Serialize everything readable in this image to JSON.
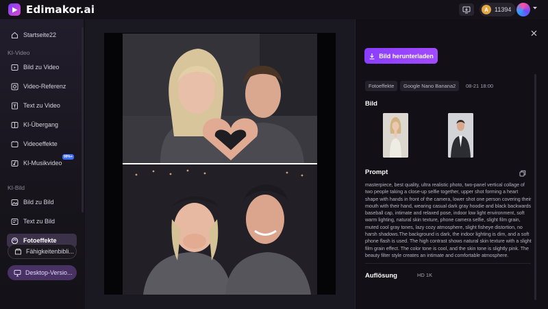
{
  "app": {
    "name": "Edimakor.ai",
    "credits": "11394"
  },
  "sidebar": {
    "home": "Startseite22",
    "video_section": "KI-Video",
    "video_items": [
      {
        "label": "Bild zu Video",
        "icon": "image-to-video-icon"
      },
      {
        "label": "Video-Referenz",
        "icon": "video-reference-icon"
      },
      {
        "label": "Text zu Video",
        "icon": "text-to-video-icon"
      },
      {
        "label": "KI-Übergang",
        "icon": "transition-icon"
      },
      {
        "label": "Videoeffekte",
        "icon": "video-effects-icon"
      },
      {
        "label": "KI-Musikvideo",
        "icon": "music-video-icon",
        "badge": "99%+"
      }
    ],
    "image_section": "KI-Bild",
    "image_items": [
      {
        "label": "Bild zu Bild",
        "icon": "image-to-image-icon"
      },
      {
        "label": "Text zu Bild",
        "icon": "text-to-image-icon"
      },
      {
        "label": "Fotoeffekte",
        "icon": "photo-effects-icon",
        "active": true
      }
    ],
    "skills_button": "Fähigkeitenbibli...",
    "desktop_button": "Desktop-Versio..."
  },
  "panel": {
    "download_label": "Bild herunterladen",
    "tags": [
      "Fotoeffekte",
      "Google Nano Banana2"
    ],
    "date": "08-21 18:00",
    "image_title": "Bild",
    "prompt_title": "Prompt",
    "prompt_text": "masterpiece, best quality, ultra realistic photo, two-panel vertical collage of two people taking a close-up selfie together, upper shot forming a heart shape with hands in front of the camera, lower shot one person covering their mouth with their hand, wearing casual dark gray hoodie and black backwards baseball cap, intimate and relaxed pose, indoor low light environment, soft warm lighting, natural skin texture, phone camera selfie, slight film grain, muted cool gray tones, lazy cozy atmosphere, slight fisheye distortion, no harsh shadows.The background is dark, the indoor lighting is dim, and a soft phone flash is used. The high contrast shows natural skin texture with a slight film grain effect. The color tone is cool, and the skin tone is slightly pink. The beauty filter style creates an intimate and comfortable atmosphere.",
    "resolution_title": "Auflösung",
    "resolution_value": "HD 1K"
  },
  "colors": {
    "accent": "#9a45ff",
    "active_nav": "#3b3249",
    "background": "#141218"
  }
}
